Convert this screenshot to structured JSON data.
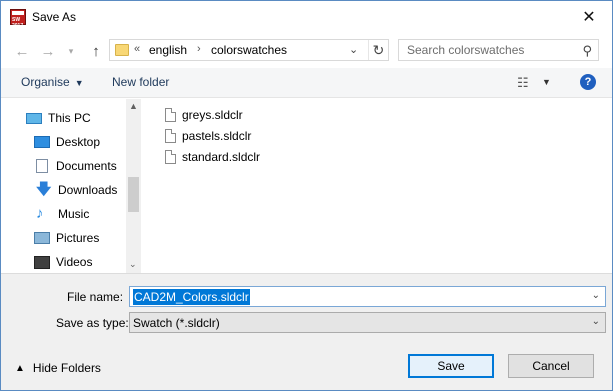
{
  "window": {
    "title": "Save As",
    "app_icon_text": "SW 2017"
  },
  "address": {
    "overflow": "«",
    "crumbs": [
      "english",
      "colorswatches"
    ],
    "separator": "›"
  },
  "search": {
    "placeholder": "Search colorswatches"
  },
  "commands": {
    "organise": "Organise",
    "new_folder": "New folder"
  },
  "nav": {
    "items": [
      {
        "label": "This PC",
        "icon": "computer-icon"
      },
      {
        "label": "Desktop",
        "icon": "desktop-icon"
      },
      {
        "label": "Documents",
        "icon": "documents-icon"
      },
      {
        "label": "Downloads",
        "icon": "downloads-icon"
      },
      {
        "label": "Music",
        "icon": "music-icon"
      },
      {
        "label": "Pictures",
        "icon": "pictures-icon"
      },
      {
        "label": "Videos",
        "icon": "videos-icon"
      }
    ]
  },
  "files": [
    {
      "name": "greys.sldclr"
    },
    {
      "name": "pastels.sldclr"
    },
    {
      "name": "standard.sldclr"
    }
  ],
  "form": {
    "file_name_label": "File name:",
    "file_name_value": "CAD2M_Colors.sldclr",
    "save_type_label": "Save as type:",
    "save_type_value": "Swatch (*.sldclr)"
  },
  "footer": {
    "hide_folders": "Hide Folders",
    "save": "Save",
    "cancel": "Cancel"
  },
  "colors": {
    "selection": "#0078d7",
    "accent_border": "#0078d7"
  }
}
